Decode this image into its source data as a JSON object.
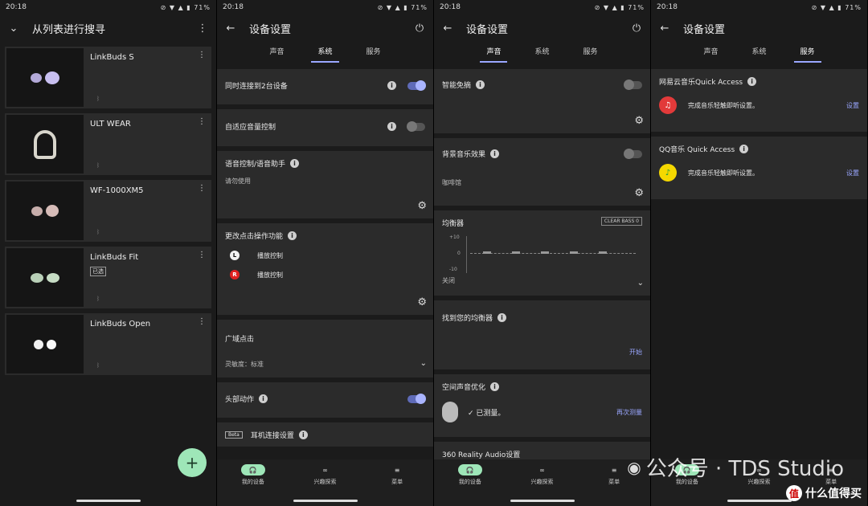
{
  "status": {
    "time": "20:18",
    "icons": "⊘ ▼ ▲ ▮ 71%"
  },
  "screen1": {
    "title": "从列表进行搜寻",
    "devices": [
      {
        "name": "LinkBuds S",
        "conn": "ᛒ",
        "badge": ""
      },
      {
        "name": "ULT WEAR",
        "conn": "ᛒ",
        "badge": ""
      },
      {
        "name": "WF-1000XM5",
        "conn": "ᛒ",
        "badge": ""
      },
      {
        "name": "LinkBuds Fit",
        "conn": "ᛒ",
        "badge": "已选"
      },
      {
        "name": "LinkBuds Open",
        "conn": "ᛒ",
        "badge": ""
      }
    ],
    "fab": "+"
  },
  "settings_title": "设备设置",
  "tabs": {
    "sound": "声音",
    "system": "系统",
    "service": "服务"
  },
  "screen2": {
    "dual": "同时连接到2台设备",
    "adaptive": "自适应音量控制",
    "voice": "语音控制/语音助手",
    "voice_sub": "请勿使用",
    "tap": "更改点击操作功能",
    "left_label": "L",
    "left_action": "播放控制",
    "right_label": "R",
    "right_action": "播放控制",
    "wide": "广域点击",
    "sensitivity": "灵敏度：标准",
    "head": "头部动作",
    "beta": "Beta",
    "earconn": "耳机连接设置"
  },
  "screen3": {
    "smart": "智能免摘",
    "bgm": "背景音乐效果",
    "bgm_sub": "咖啡馆",
    "eq": "均衡器",
    "clear_bass": "CLEAR BASS  0",
    "eq_top": "+10",
    "eq_mid": "0",
    "eq_bot": "-10",
    "eq_state": "关闭",
    "find_eq": "找到您的均衡器",
    "start": "开始",
    "spatial": "空间声音优化",
    "measured": "✓ 已测量。",
    "remeasure": "再次测量",
    "reality": "360 Reality Audio设置"
  },
  "screen4": {
    "netease": "网易云音乐Quick Access",
    "netease_sub": "完成音乐轻触即听设置。",
    "set1": "设置",
    "qq": "QQ音乐 Quick Access",
    "qq_sub": "完成音乐轻触即听设置。",
    "set2": "设置"
  },
  "nav": {
    "devices": "我的设备",
    "discover": "兴趣探索",
    "menu": "菜单"
  },
  "watermark": "公众号 · TDS Studio",
  "brand": "什么值得买",
  "brand_logo": "值",
  "colors": {
    "accent": "#9aa7ff",
    "fab": "#9ee6b8"
  }
}
